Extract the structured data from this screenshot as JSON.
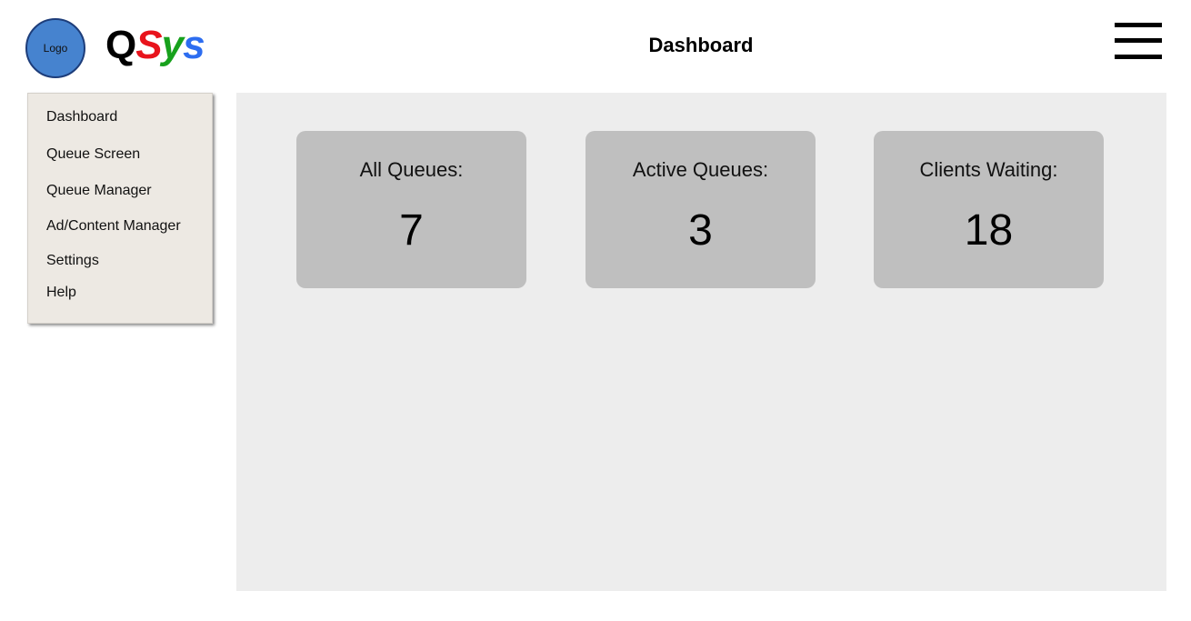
{
  "header": {
    "logo_text": "Logo",
    "brand": {
      "q": "Q",
      "s": "S",
      "y": "y",
      "s2": "s"
    },
    "title": "Dashboard",
    "menu_icon": "hamburger-menu-icon"
  },
  "sidebar": {
    "items": [
      {
        "label": "Dashboard"
      },
      {
        "label": "Queue Screen"
      },
      {
        "label": "Queue Manager"
      },
      {
        "label": "Ad/Content Manager"
      },
      {
        "label": "Settings"
      },
      {
        "label": "Help"
      }
    ]
  },
  "stats": [
    {
      "label": "All Queues:",
      "value": "7"
    },
    {
      "label": "Active Queues:",
      "value": "3"
    },
    {
      "label": "Clients Waiting:",
      "value": "18"
    }
  ],
  "colors": {
    "logo_fill": "#4683cf",
    "brand_s": "#e8141c",
    "brand_y": "#17a11c",
    "brand_s2": "#2d6df0",
    "card_bg": "#bfbfbf",
    "main_bg": "#ededed",
    "sidebar_bg": "#ede9e3"
  }
}
